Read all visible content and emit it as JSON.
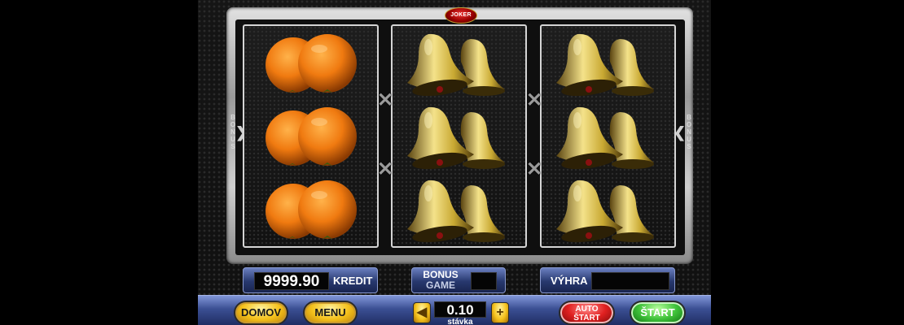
{
  "logo_text": "JOKER",
  "side_label": "BONUS",
  "reels": [
    {
      "name": "reel-1",
      "symbol": "orange",
      "symbols": [
        "orange",
        "orange",
        "orange"
      ]
    },
    {
      "name": "reel-2",
      "symbol": "bell",
      "symbols": [
        "bell",
        "bell",
        "bell"
      ]
    },
    {
      "name": "reel-3",
      "symbol": "bell",
      "symbols": [
        "bell",
        "bell",
        "bell"
      ]
    }
  ],
  "panels": {
    "credit_value": "9999.90",
    "credit_label": "KREDIT",
    "bonus_label_1": "BONUS",
    "bonus_label_2": "GAME",
    "win_label": "VÝHRA"
  },
  "controls": {
    "home_label": "DOMOV",
    "menu_label": "MENU",
    "bet_value": "0.10",
    "bet_label": "stávka",
    "auto_label_1": "AUTO",
    "auto_label_2": "ŠTART",
    "start_label": "ŠTART"
  },
  "icons": {
    "decrease": "◀",
    "increase": "+",
    "separator": "✕",
    "bonus_arrow_left": "❯",
    "bonus_arrow_right": "❮"
  },
  "colors": {
    "orange": "#f07a10",
    "bell": "#c8a832",
    "panel_blue": "#27386e",
    "start_green": "#3fc23a",
    "auto_red": "#e02020",
    "button_yellow": "#f5c21c"
  }
}
